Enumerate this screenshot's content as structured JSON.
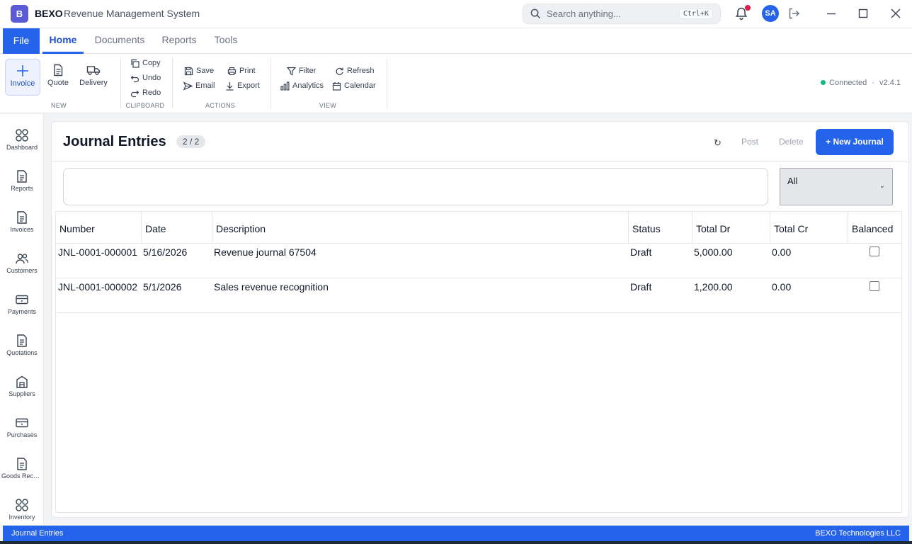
{
  "app": {
    "logo_letter": "B",
    "name": "BEXO",
    "subtitle": "Revenue Management System"
  },
  "search": {
    "placeholder": "Search anything...",
    "shortcut": "Ctrl+K"
  },
  "user": {
    "initials": "SA"
  },
  "tabs": {
    "file": "File",
    "items": [
      "Home",
      "Documents",
      "Reports",
      "Tools"
    ],
    "active": "Home"
  },
  "ribbon": {
    "new_group": {
      "label": "NEW",
      "buttons": [
        "Invoice",
        "Quote",
        "Delivery"
      ]
    },
    "clipboard_group": {
      "label": "CLIPBOARD",
      "buttons": [
        "Copy",
        "Undo",
        "Redo"
      ]
    },
    "actions_group": {
      "label": "ACTIONS",
      "buttons": [
        "Save",
        "Print",
        "Email",
        "Export"
      ]
    },
    "view_group": {
      "label": "VIEW",
      "buttons": [
        "Filter",
        "Refresh",
        "Analytics",
        "Calendar"
      ]
    },
    "connection": {
      "status": "Connected",
      "separator": "·",
      "version": "v2.4.1"
    }
  },
  "sidebar": {
    "items": [
      "Dashboard",
      "Reports",
      "Invoices",
      "Customers",
      "Payments",
      "Quotations",
      "Suppliers",
      "Purchases",
      "Goods Receipts",
      "Inventory"
    ]
  },
  "page": {
    "title": "Journal Entries",
    "count": "2 / 2",
    "refresh_glyph": "↻",
    "post_label": "Post",
    "delete_label": "Delete",
    "new_label": "+ New Journal",
    "filter_value": "",
    "status_filter": "All"
  },
  "table": {
    "columns": [
      "Number",
      "Date",
      "Description",
      "Status",
      "Total Dr",
      "Total Cr",
      "Balanced"
    ],
    "rows": [
      {
        "number": "JNL-0001-000001",
        "date": "5/16/2026",
        "description": "Revenue journal 67504",
        "status": "Draft",
        "total_dr": "5,000.00",
        "total_cr": "0.00",
        "balanced": false
      },
      {
        "number": "JNL-0001-000002",
        "date": "5/1/2026",
        "description": "Sales revenue recognition",
        "status": "Draft",
        "total_dr": "1,200.00",
        "total_cr": "0.00",
        "balanced": false
      }
    ]
  },
  "statusbar": {
    "left": "Journal Entries",
    "right": "BEXO Technologies LLC"
  },
  "colors": {
    "accent": "#2563eb",
    "logo": "#5b5bd6",
    "connected": "#10b981",
    "notification": "#e11d48"
  }
}
